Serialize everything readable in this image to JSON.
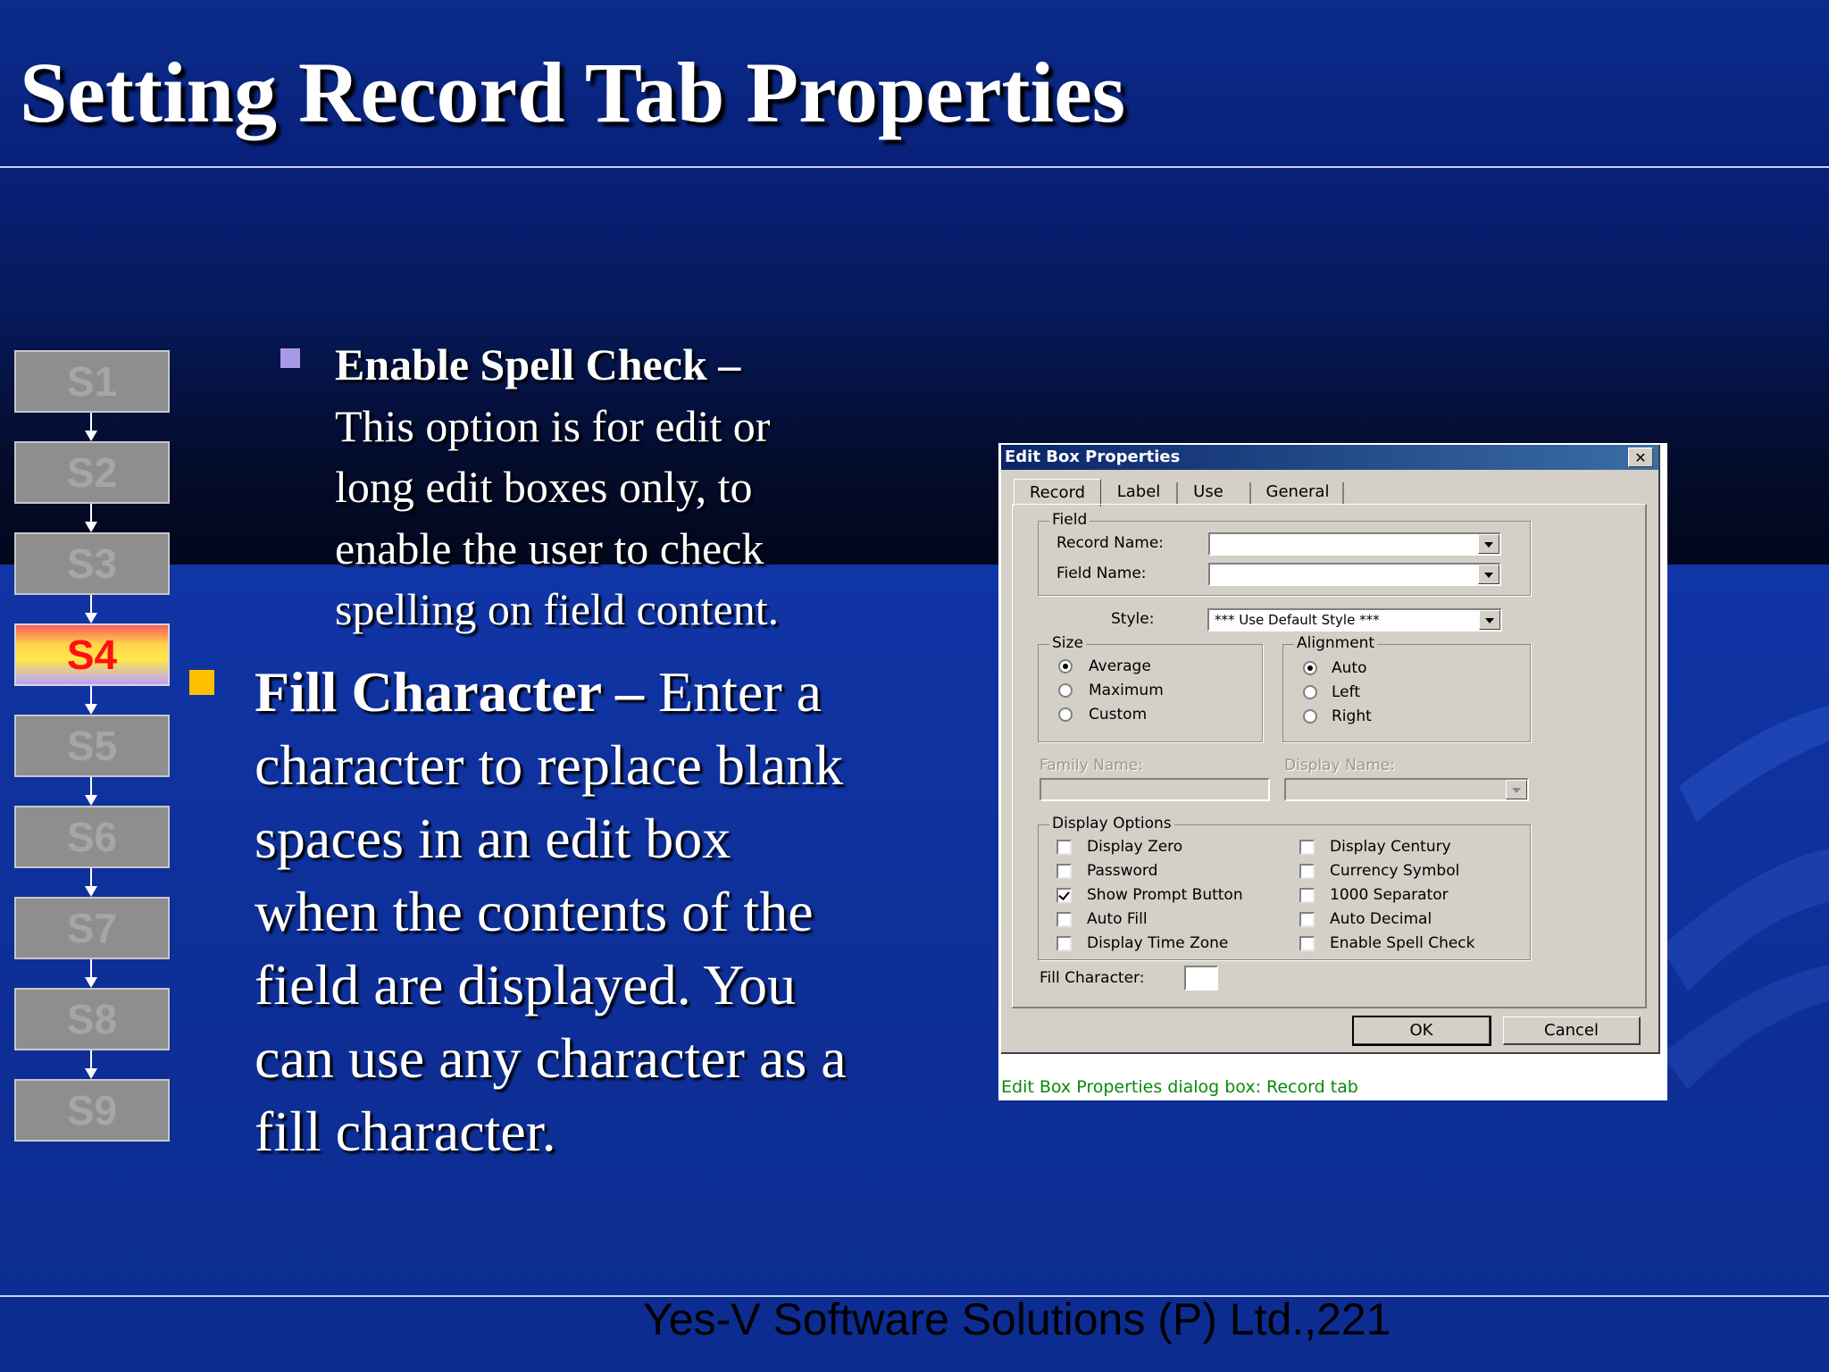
{
  "slide": {
    "title": "Setting Record Tab Properties",
    "footer": "Yes-V Software Solutions (P) Ltd.,221"
  },
  "steps": {
    "items": [
      "S1",
      "S2",
      "S3",
      "S4",
      "S5",
      "S6",
      "S7",
      "S8",
      "S9"
    ],
    "active": "S4"
  },
  "bullets": {
    "sub": {
      "heading": "Enable Spell Check –",
      "lines": [
        "This option is for edit or",
        "long edit boxes only, to",
        "enable the user to check",
        "spelling on field content."
      ]
    },
    "main": {
      "heading": "Fill Character –",
      "heading_tail": " Enter a",
      "lines": [
        "character to replace blank",
        "spaces in an edit box",
        "when the contents of the",
        "field are displayed. You",
        "can use any character as a",
        "fill character."
      ]
    }
  },
  "colors": {
    "sub_bullet": "#a899e8",
    "main_bullet": "#ffc000",
    "caption": "#0a8a0a"
  },
  "dialog": {
    "title": "Edit Box Properties",
    "close_label": "✕",
    "tabs": [
      "Record",
      "Label",
      "Use",
      "General"
    ],
    "selected_tab": "Record",
    "field_group": "Field",
    "record_name_label": "Record Name:",
    "record_name_value": "",
    "field_name_label": "Field Name:",
    "field_name_value": "",
    "style_label": "Style:",
    "style_value": "*** Use Default Style ***",
    "size_group": "Size",
    "size_options": [
      "Average",
      "Maximum",
      "Custom"
    ],
    "size_selected": "Average",
    "alignment_group": "Alignment",
    "alignment_options": [
      "Auto",
      "Left",
      "Right"
    ],
    "alignment_selected": "Auto",
    "family_name_label": "Family Name:",
    "display_name_label": "Display Name:",
    "display_options_group": "Display Options",
    "options_left": [
      {
        "label": "Display Zero",
        "checked": false
      },
      {
        "label": "Password",
        "checked": false
      },
      {
        "label": "Show Prompt Button",
        "checked": true
      },
      {
        "label": "Auto Fill",
        "checked": false
      },
      {
        "label": "Display Time Zone",
        "checked": false
      }
    ],
    "options_right": [
      {
        "label": "Display Century",
        "checked": false
      },
      {
        "label": "Currency Symbol",
        "checked": false
      },
      {
        "label": "1000 Separator",
        "checked": false
      },
      {
        "label": "Auto Decimal",
        "checked": false
      },
      {
        "label": "Enable Spell Check",
        "checked": false
      }
    ],
    "fill_character_label": "Fill Character:",
    "fill_character_value": "",
    "ok_label": "OK",
    "cancel_label": "Cancel",
    "caption": "Edit Box Properties dialog box: Record tab"
  }
}
